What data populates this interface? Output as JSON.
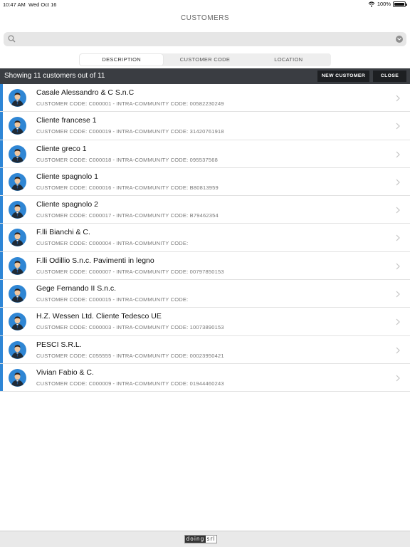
{
  "status": {
    "time": "10:47 AM",
    "date": "Wed Oct 16",
    "battery": "100%",
    "battery_level": 1.0
  },
  "title": "CUSTOMERS",
  "search": {
    "value": "",
    "placeholder": ""
  },
  "tabs": [
    {
      "label": "DESCRIPTION",
      "active": true
    },
    {
      "label": "CUSTOMER CODE",
      "active": false
    },
    {
      "label": "LOCATION",
      "active": false
    }
  ],
  "header": {
    "count_text": "Showing 11 customers out of 11",
    "new_label": "NEW CUSTOMER",
    "close_label": "CLOSE"
  },
  "colors": {
    "accent": "#2e86d6",
    "header_bg": "#3a3d42",
    "button_bg": "#1d1f22"
  },
  "customers": [
    {
      "name": "Casale Alessandro & C S.n.C",
      "code": "CUSTOMER CODE: C000001",
      "intra": "INTRA-COMMUNITY CODE: 00582230249"
    },
    {
      "name": "Cliente francese 1",
      "code": "CUSTOMER CODE: C000019",
      "intra": "INTRA-COMMUNITY CODE: 31420761918"
    },
    {
      "name": "Cliente greco 1",
      "code": "CUSTOMER CODE: C000018",
      "intra": "INTRA-COMMUNITY CODE: 095537568"
    },
    {
      "name": "Cliente spagnolo 1",
      "code": "CUSTOMER CODE: C000016",
      "intra": "INTRA-COMMUNITY CODE: B80813959"
    },
    {
      "name": "Cliente spagnolo 2",
      "code": "CUSTOMER CODE: C000017",
      "intra": "INTRA-COMMUNITY CODE: B79462354"
    },
    {
      "name": "F.lli Bianchi & C.",
      "code": "CUSTOMER CODE: C000004",
      "intra": "INTRA-COMMUNITY CODE:"
    },
    {
      "name": "F.lli Odillio S.n.c. Pavimenti in legno",
      "code": "CUSTOMER CODE: C000007",
      "intra": "INTRA-COMMUNITY CODE: 00797850153"
    },
    {
      "name": "Gege Fernando II S.n.c.",
      "code": "CUSTOMER CODE: C000015",
      "intra": "INTRA-COMMUNITY CODE:"
    },
    {
      "name": "H.Z. Wessen Ltd. Cliente Tedesco UE",
      "code": "CUSTOMER CODE: C000003",
      "intra": "INTRA-COMMUNITY CODE: 10073890153"
    },
    {
      "name": "PESCI S.R.L.",
      "code": "CUSTOMER CODE: C055555",
      "intra": "INTRA-COMMUNITY CODE: 00023950421"
    },
    {
      "name": "Vivian Fabio & C.",
      "code": "CUSTOMER CODE: C000009",
      "intra": "INTRA-COMMUNITY CODE: 01944460243"
    }
  ],
  "separator": "-",
  "footer": {
    "logo_part1": "doing",
    "logo_part2": "srl"
  },
  "icons": {
    "search": "search-icon",
    "clear": "clear-icon",
    "avatar": "person-avatar-icon",
    "chevron": "chevron-right-icon",
    "wifi": "wifi-icon",
    "battery": "battery-icon"
  }
}
